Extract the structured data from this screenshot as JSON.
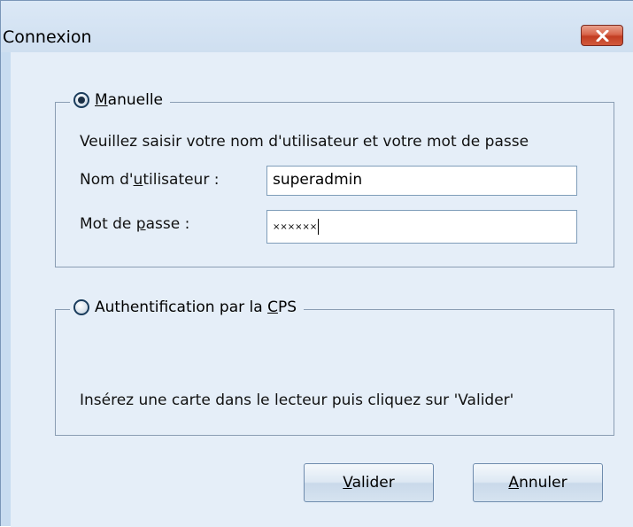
{
  "window": {
    "title": "Connexion",
    "close_label": "×"
  },
  "manual": {
    "label_prefix": "",
    "label_hotkey": "M",
    "label_rest": "anuelle",
    "selected": true,
    "instructions": "Veuillez saisir votre nom d'utilisateur et votre mot de passe",
    "username_label_pre": "Nom d'",
    "username_label_hotkey": "u",
    "username_label_post": "tilisateur :",
    "username_value": "superadmin",
    "password_label_pre": "Mot de ",
    "password_label_hotkey": "p",
    "password_label_post": "asse :",
    "password_mask": "××××××"
  },
  "cps": {
    "label_pre": "Authentification par la ",
    "label_hotkey": "C",
    "label_post": "PS",
    "selected": false,
    "instructions": "Insérez une carte dans le lecteur puis cliquez sur 'Valider'"
  },
  "buttons": {
    "validate_hotkey": "V",
    "validate_rest": "alider",
    "cancel_hotkey": "A",
    "cancel_rest": "nnuler"
  }
}
